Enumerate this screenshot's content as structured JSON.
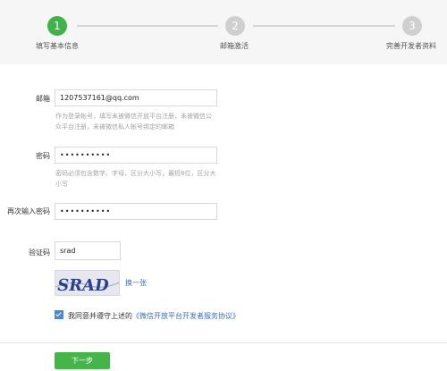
{
  "steps": [
    {
      "number": "1",
      "label": "填写基本信息"
    },
    {
      "number": "2",
      "label": "邮箱激活"
    },
    {
      "number": "3",
      "label": "完善开发者资料"
    }
  ],
  "form": {
    "email_label": "邮箱",
    "email_value": "1207537161@qq.com",
    "email_hint": "作为登录帐号，填写未被微信开放平台注册，未被微信公众平台注册，未被微信私人帐号绑定的邮箱",
    "password_label": "密码",
    "password_value": "••••••••••",
    "password_hint": "密码必须包含数字、字母，区分大小写，最短8位，区分大小写",
    "confirm_label": "再次输入密码",
    "confirm_value": "••••••••••",
    "captcha_label": "验证码",
    "captcha_value": "srad",
    "captcha_image_text": "SRAD",
    "refresh_label": "换一张",
    "agree_text": "我同意并遵守上述的",
    "agree_link": "《微信开放平台开发者服务协议》",
    "agree_checked": true
  },
  "next_button": "下一步",
  "colors": {
    "accent_green": "#44b549",
    "link_blue": "#3b6fb6",
    "step_inactive": "#cfcfcf"
  }
}
